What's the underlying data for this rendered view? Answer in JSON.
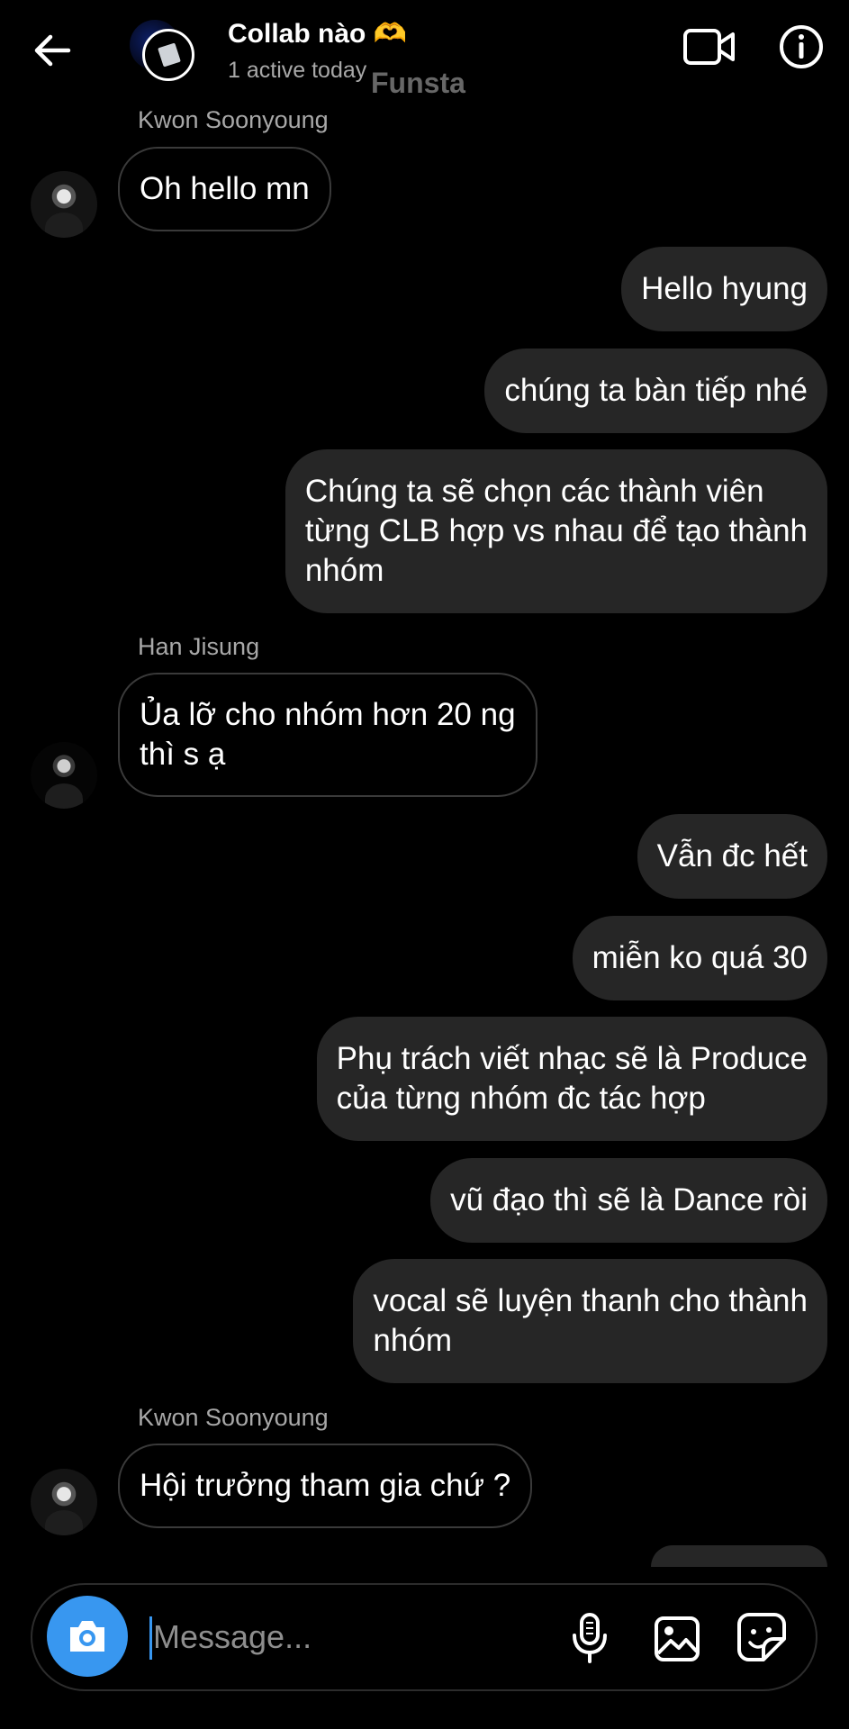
{
  "header": {
    "title": "Collab nào 🫶",
    "subtitle": "1 active today",
    "watermark": "Funsta"
  },
  "messages": [
    {
      "sender": "Kwon Soonyoung",
      "text": "Oh hello mn"
    },
    {
      "text": "Hello hyung"
    },
    {
      "text": "chúng ta bàn tiếp nhé"
    },
    {
      "text": "Chúng ta sẽ chọn các thành viên\ntừng CLB hợp vs nhau để tạo thành\nnhóm"
    },
    {
      "sender": "Han Jisung",
      "text": "Ủa lỡ cho nhóm hơn 20 ng\nthì s ạ"
    },
    {
      "text": "Vẫn đc hết"
    },
    {
      "text": "miễn ko quá 30"
    },
    {
      "text": "Phụ trách viết nhạc sẽ là Produce\ncủa từng nhóm đc tác hợp"
    },
    {
      "text": "vũ đạo thì sẽ là Dance ròi"
    },
    {
      "text": "vocal sẽ luyện thanh cho thành\nnhóm"
    },
    {
      "sender": "Kwon Soonyoung",
      "text": "Hội trưởng tham gia chứ ?"
    }
  ],
  "composer": {
    "placeholder": "Message..."
  },
  "colors": {
    "background": "#000000",
    "outgoing_bubble": "#262626",
    "incoming_border": "#3a3a3a",
    "camera_button": "#3897f0",
    "secondary_text": "#a8a8a8"
  },
  "icons": [
    "back-arrow-icon",
    "video-call-icon",
    "info-icon",
    "camera-icon",
    "microphone-icon",
    "gallery-icon",
    "sticker-icon"
  ]
}
